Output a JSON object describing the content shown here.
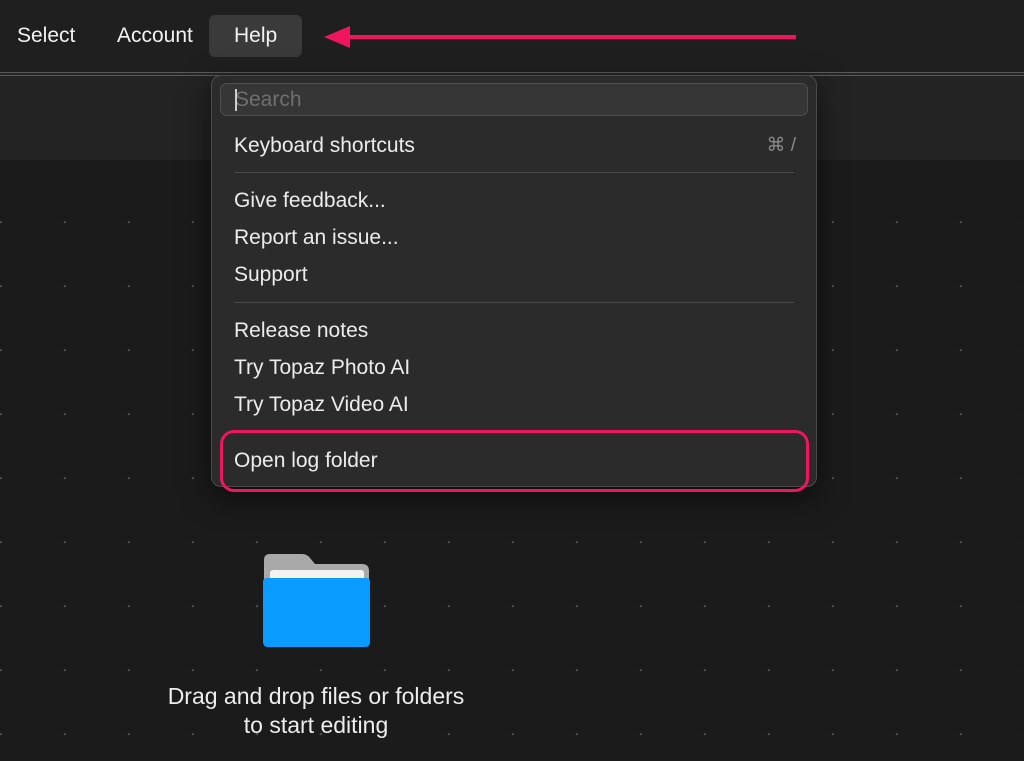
{
  "menubar": {
    "items": [
      {
        "label": "Select"
      },
      {
        "label": "Account"
      },
      {
        "label": "Help"
      }
    ]
  },
  "help_menu": {
    "search_placeholder": "Search",
    "items": [
      {
        "label": "Keyboard shortcuts",
        "shortcut": "⌘ /"
      },
      {
        "label": "Give feedback..."
      },
      {
        "label": "Report an issue..."
      },
      {
        "label": "Support"
      },
      {
        "label": "Release notes"
      },
      {
        "label": "Try Topaz Photo AI"
      },
      {
        "label": "Try Topaz Video AI"
      },
      {
        "label": "Open log folder"
      }
    ]
  },
  "dropzone": {
    "line1": "Drag and drop files or folders",
    "line2": "to start editing"
  },
  "colors": {
    "annotation": "#f0155f",
    "folder": "#0a9bff"
  }
}
